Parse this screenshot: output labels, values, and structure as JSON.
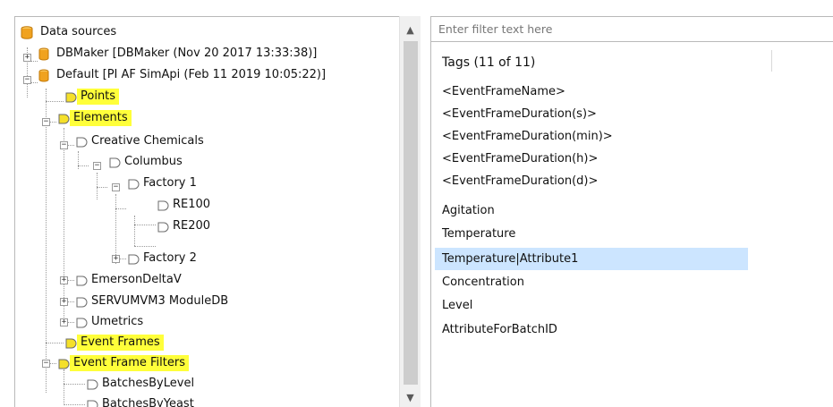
{
  "tree": {
    "root_label": "Data sources",
    "nodes": [
      {
        "label": "DBMaker [DBMaker (Nov 20 2017 13:33:38)]"
      },
      {
        "label": "Default [PI AF SimApi (Feb 11 2019 10:05:22)]"
      },
      {
        "label": "Points"
      },
      {
        "label": "Elements"
      },
      {
        "label": "Creative Chemicals"
      },
      {
        "label": "Columbus"
      },
      {
        "label": "Factory 1"
      },
      {
        "label": "RE100"
      },
      {
        "label": "RE200"
      },
      {
        "label": "Factory 2"
      },
      {
        "label": "EmersonDeltaV"
      },
      {
        "label": "SERVUMVM3 ModuleDB"
      },
      {
        "label": "Umetrics"
      },
      {
        "label": "Event Frames"
      },
      {
        "label": "Event Frame Filters"
      },
      {
        "label": "BatchesByLevel"
      },
      {
        "label": "BatchesByYeast"
      }
    ],
    "expander_collapsed": "+",
    "expander_expanded": "−"
  },
  "scrollbar": {
    "up_arrow": "▲",
    "down_arrow": "▼"
  },
  "filter": {
    "placeholder": "Enter filter text here",
    "value": ""
  },
  "tags": {
    "header": "Tags (11 of 11)",
    "items": [
      "<EventFrameName>",
      "<EventFrameDuration(s)>",
      "<EventFrameDuration(min)>",
      "<EventFrameDuration(h)>",
      "<EventFrameDuration(d)>",
      "Agitation",
      "Temperature",
      "Temperature|Attribute1",
      "Concentration",
      "Level",
      "AttributeForBatchID"
    ],
    "selected_index": 7
  },
  "colors": {
    "highlight": "#ffff3a",
    "selection": "#cce5ff",
    "db_icon": "#f0a21f",
    "node_icon_highlighted": "#f5e02a",
    "node_icon_plain": "#ffffff"
  }
}
